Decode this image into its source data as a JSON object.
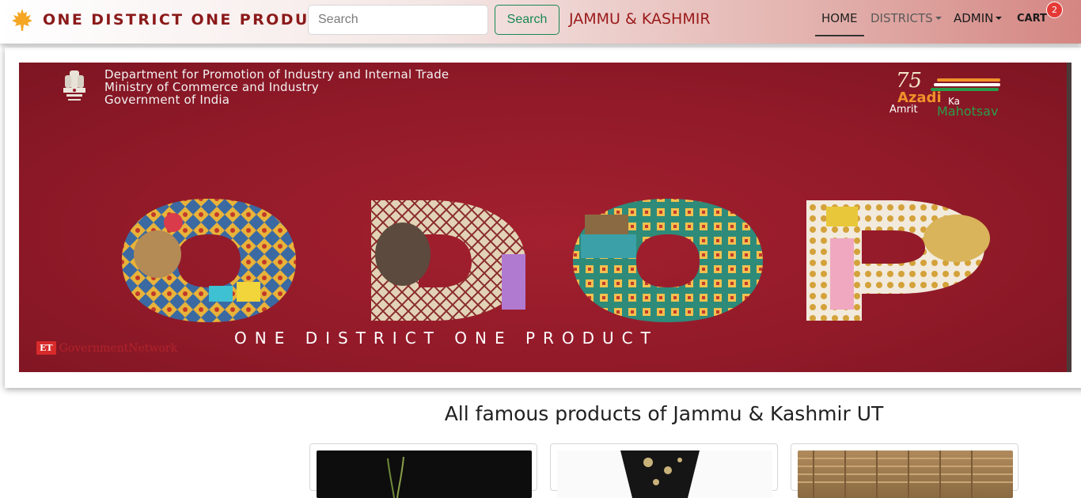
{
  "navbar": {
    "brand": "ONE DISTRICT ONE PRODUCT",
    "search_placeholder": "Search",
    "search_button": "Search",
    "region": "JAMMU & KASHMIR",
    "nav": {
      "home": "HOME",
      "districts": "DISTRICTS",
      "admin": "ADMIN",
      "cart": "CART",
      "cart_count": "2"
    }
  },
  "banner": {
    "department_lines": [
      "Department for Promotion of Industry and Internal Trade",
      "Ministry of Commerce and Industry",
      "Government of India"
    ],
    "azadi": {
      "number": "75",
      "word1": "Azadi",
      "ka": "Ka",
      "amrit": "Amrit",
      "mahotsav": "Mahotsav"
    },
    "big_text": "ODOP",
    "tagline": "ONE DISTRICT ONE PRODUCT",
    "et_logo": "ET",
    "et_text": "GovernmentNetwork"
  },
  "section": {
    "title": "All famous products of Jammu & Kashmir UT"
  },
  "products": [
    {
      "icon": "product-image-dark"
    },
    {
      "icon": "product-image-embroidery"
    },
    {
      "icon": "product-image-wicker"
    }
  ],
  "colors": {
    "brand": "#8b1a1a",
    "search_green": "#198754",
    "banner_red": "#921a29",
    "badge_red": "#e53935"
  }
}
